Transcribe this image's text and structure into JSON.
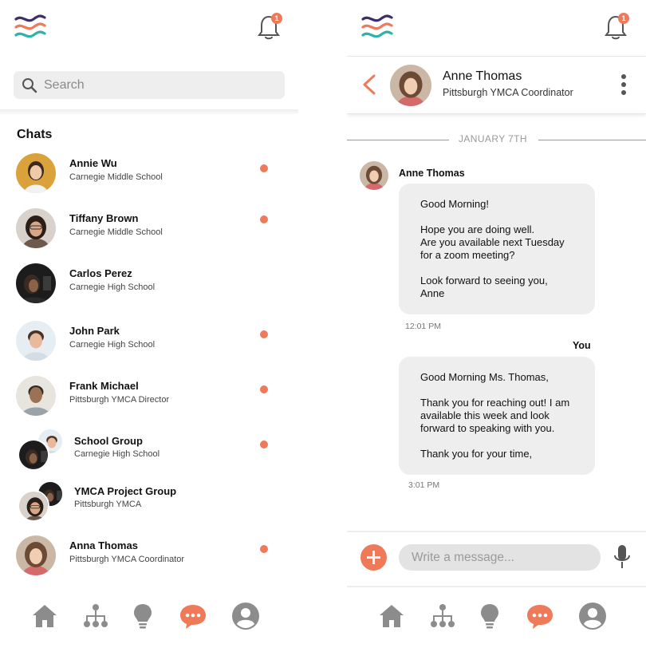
{
  "colors": {
    "accent": "#EE7A5A",
    "icon_gray": "#8C8C8C",
    "logo_purple": "#3D2E6B",
    "logo_teal": "#2BB3A7"
  },
  "notifications": {
    "count": "1"
  },
  "left": {
    "search": {
      "placeholder": "Search"
    },
    "chats_heading": "Chats",
    "chats": [
      {
        "name": "Annie Wu",
        "subtitle": "Carnegie Middle School",
        "unread": true
      },
      {
        "name": "Tiffany Brown",
        "subtitle": "Carnegie Middle School",
        "unread": true
      },
      {
        "name": "Carlos Perez",
        "subtitle": "Carnegie High School",
        "unread": false
      },
      {
        "name": "John Park",
        "subtitle": "Carnegie High School",
        "unread": true
      },
      {
        "name": "Frank Michael",
        "subtitle": "Pittsburgh YMCA Director",
        "unread": true
      },
      {
        "name": "School Group",
        "subtitle": "Carnegie High School",
        "unread": true
      },
      {
        "name": "YMCA Project Group",
        "subtitle": "Pittsburgh YMCA",
        "unread": false
      },
      {
        "name": "Anna Thomas",
        "subtitle": "Pittsburgh YMCA Coordinator",
        "unread": true
      }
    ]
  },
  "nav": {
    "items": [
      {
        "icon": "home-icon",
        "active": false
      },
      {
        "icon": "network-icon",
        "active": false
      },
      {
        "icon": "lightbulb-icon",
        "active": false
      },
      {
        "icon": "chat-bubble-icon",
        "active": true
      },
      {
        "icon": "profile-icon",
        "active": false
      }
    ]
  },
  "right": {
    "header": {
      "name": "Anne Thomas",
      "subtitle": "Pittsburgh YMCA Coordinator"
    },
    "date_separator": "JANUARY 7TH",
    "messages": [
      {
        "sender": "Anne Thomas",
        "text": "Good Morning!\n\nHope you are doing well.\nAre you available next Tuesday\nfor a zoom meeting?\n\nLook forward to seeing you,\nAnne",
        "time": "12:01 PM"
      },
      {
        "sender": "You",
        "text": "Good Morning Ms. Thomas,\n\nThank you for reaching out! I am\navailable this week and look\nforward to speaking with you.\n\nThank you for your time,",
        "time": "3:01 PM"
      }
    ],
    "compose": {
      "placeholder": "Write a message..."
    }
  }
}
